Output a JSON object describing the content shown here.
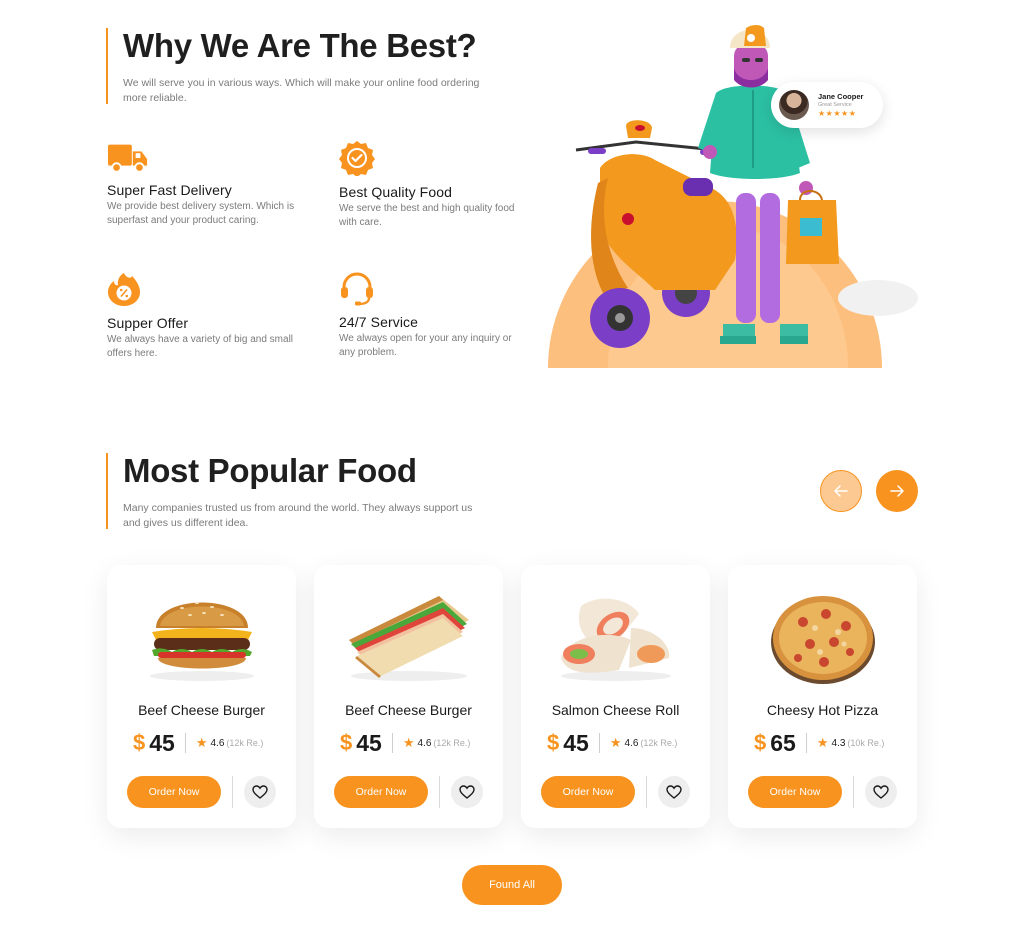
{
  "why": {
    "title": "Why We Are The Best?",
    "subtitle": "We will serve you in various ways. Which will make your online food ordering more reliable."
  },
  "features": [
    {
      "icon": "truck-icon",
      "title": "Super Fast Delivery",
      "desc": "We provide best delivery system. Which is superfast and your product caring."
    },
    {
      "icon": "quality-badge-icon",
      "title": "Best Quality Food",
      "desc": "We serve the best and high quality food with care."
    },
    {
      "icon": "offer-fire-icon",
      "title": "Supper Offer",
      "desc": "We always have a variety of big and small offers here."
    },
    {
      "icon": "headset-icon",
      "title": "24/7 Service",
      "desc": "We always open for your any inquiry or any problem."
    }
  ],
  "review": {
    "name": "Jane Cooper",
    "subtitle": "Great Service",
    "stars": "★★★★★"
  },
  "popular": {
    "title": "Most Popular Food",
    "subtitle": "Many companies trusted us from around the world. They always support us and gives us different idea."
  },
  "foods": [
    {
      "name": "Beef Cheese Burger",
      "currency": "$",
      "price": "45",
      "rating": "4.6",
      "reviews": "(12k Re.)",
      "image": "burger"
    },
    {
      "name": "Beef Cheese Burger",
      "currency": "$",
      "price": "45",
      "rating": "4.6",
      "reviews": "(12k Re.)",
      "image": "sandwich"
    },
    {
      "name": "Salmon Cheese Roll",
      "currency": "$",
      "price": "45",
      "rating": "4.6",
      "reviews": "(12k Re.)",
      "image": "wrap"
    },
    {
      "name": "Cheesy Hot Pizza",
      "currency": "$",
      "price": "65",
      "rating": "4.3",
      "reviews": "(10k Re.)",
      "image": "pizza"
    }
  ],
  "order_label": "Order Now",
  "found_all_label": "Found All",
  "colors": {
    "accent": "#f7931e",
    "accent_light": "#fcc992",
    "text": "#1a1a1a",
    "muted": "#7b7b7b"
  }
}
